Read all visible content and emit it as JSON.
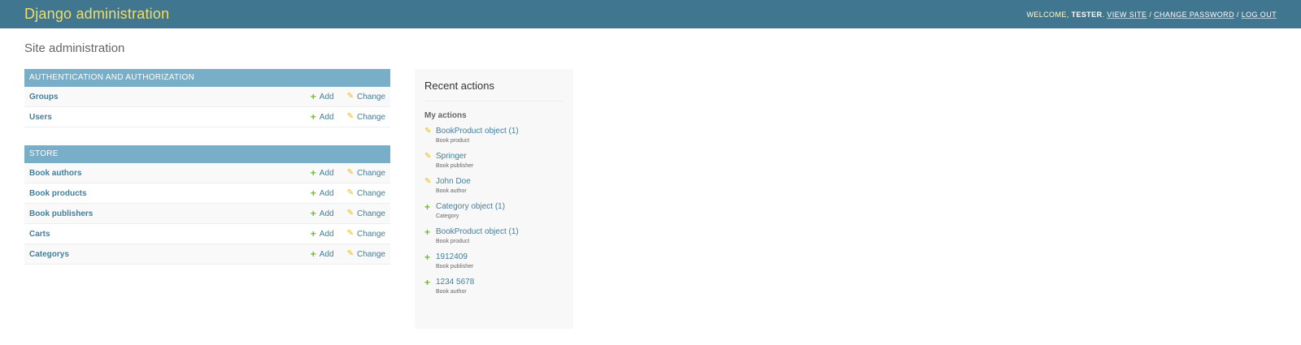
{
  "header": {
    "title": "Django administration",
    "welcome": "WELCOME,",
    "username": "TESTER",
    "view_site": "VIEW SITE",
    "change_password": "CHANGE PASSWORD",
    "log_out": "LOG OUT",
    "sep": "/"
  },
  "page_title": "Site administration",
  "apps": [
    {
      "caption": "AUTHENTICATION AND AUTHORIZATION",
      "models": [
        {
          "name": "Groups",
          "add": "Add",
          "change": "Change"
        },
        {
          "name": "Users",
          "add": "Add",
          "change": "Change"
        }
      ]
    },
    {
      "caption": "STORE",
      "models": [
        {
          "name": "Book authors",
          "add": "Add",
          "change": "Change"
        },
        {
          "name": "Book products",
          "add": "Add",
          "change": "Change"
        },
        {
          "name": "Book publishers",
          "add": "Add",
          "change": "Change"
        },
        {
          "name": "Carts",
          "add": "Add",
          "change": "Change"
        },
        {
          "name": "Categorys",
          "add": "Add",
          "change": "Change"
        }
      ]
    }
  ],
  "recent": {
    "title": "Recent actions",
    "subtitle": "My actions",
    "items": [
      {
        "icon": "change",
        "title": "BookProduct object (1)",
        "type": "Book product"
      },
      {
        "icon": "change",
        "title": "Springer",
        "type": "Book publisher"
      },
      {
        "icon": "change",
        "title": "John Doe",
        "type": "Book author"
      },
      {
        "icon": "add",
        "title": "Category object (1)",
        "type": "Category"
      },
      {
        "icon": "add",
        "title": "BookProduct object (1)",
        "type": "Book product"
      },
      {
        "icon": "add",
        "title": "1912409",
        "type": "Book publisher"
      },
      {
        "icon": "add",
        "title": "1234 5678",
        "type": "Book author"
      }
    ]
  },
  "colors": {
    "header_bg": "#417690",
    "brand": "#f5dd5d",
    "caption_bg": "#79aec8",
    "link": "#447e9b",
    "add": "#70bf2b",
    "change": "#efb80b"
  }
}
